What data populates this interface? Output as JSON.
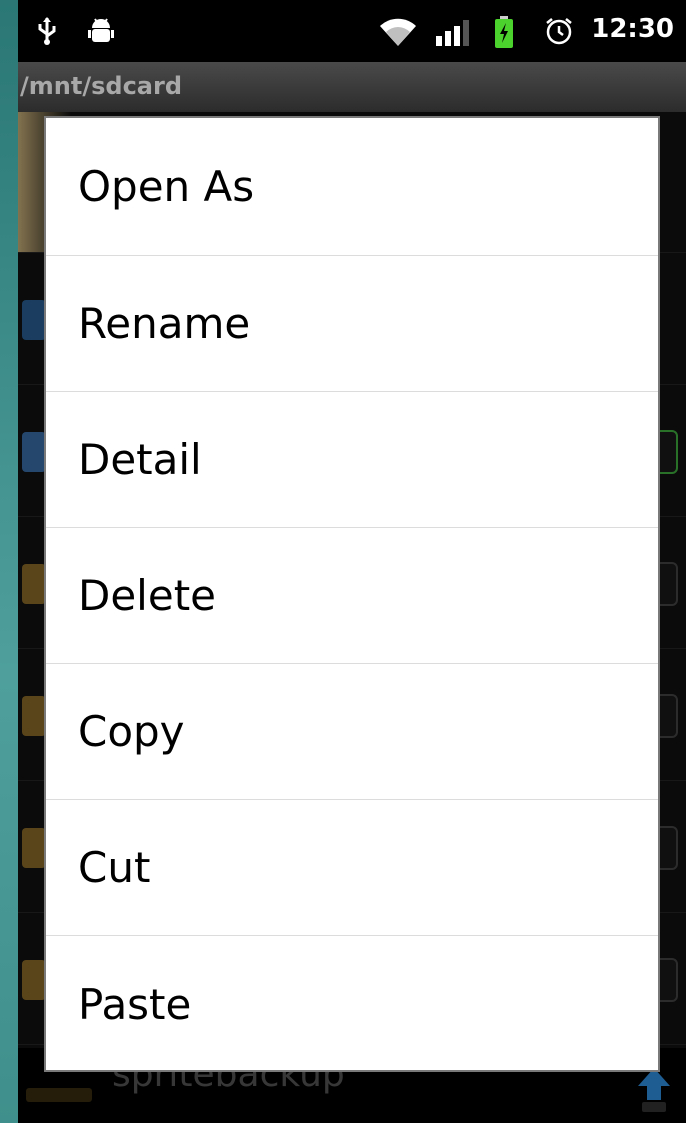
{
  "status_bar": {
    "time": "12:30",
    "icons": [
      "usb-icon",
      "android-debug-icon",
      "wifi-icon",
      "signal-icon",
      "battery-charging-icon",
      "alarm-icon"
    ]
  },
  "path_bar": {
    "path": "/mnt/sdcard"
  },
  "file_list": {
    "visible_bottom_item": "spritebackup"
  },
  "context_menu": {
    "items": [
      {
        "label": "Open As"
      },
      {
        "label": "Rename"
      },
      {
        "label": "Detail"
      },
      {
        "label": "Delete"
      },
      {
        "label": "Copy"
      },
      {
        "label": "Cut"
      },
      {
        "label": "Paste"
      }
    ]
  },
  "colors": {
    "frame": "#3e8a88",
    "menu_background": "#ffffff",
    "menu_text": "#000000",
    "battery_green": "#4cd22c"
  }
}
